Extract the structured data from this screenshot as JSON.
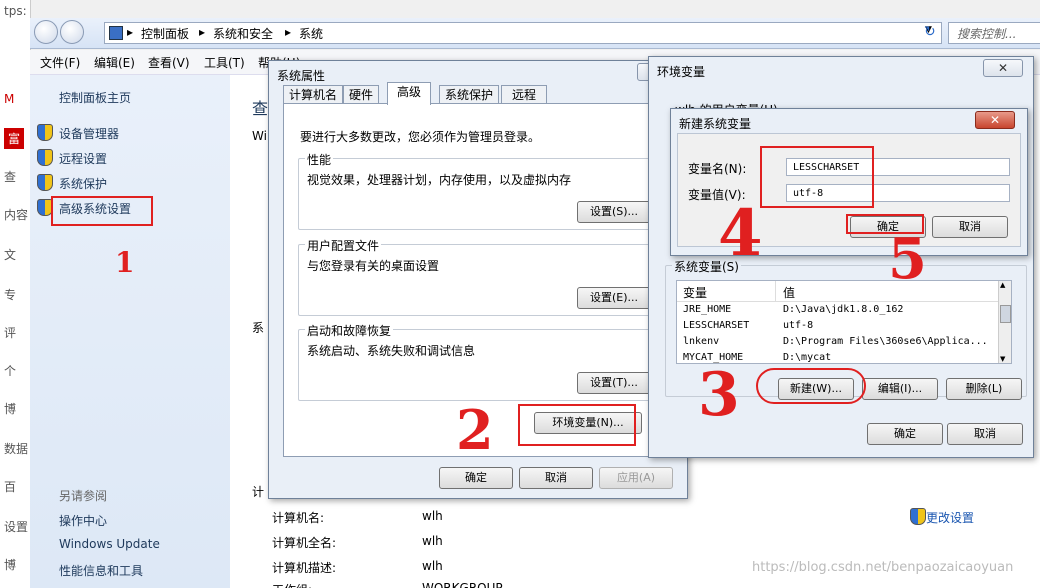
{
  "browser": {
    "url_fragment": "tps:",
    "side_labels": [
      "M",
      "富",
      "查",
      "内容",
      "文",
      "专",
      "评",
      "个",
      "博",
      "数据",
      "百",
      "设置",
      "博"
    ]
  },
  "explorer": {
    "breadcrumb": [
      "控制面板",
      "系统和安全",
      "系统"
    ],
    "search_placeholder": "搜索控制...",
    "menu": [
      "文件(F)",
      "编辑(E)",
      "查看(V)",
      "工具(T)",
      "帮助(H)"
    ],
    "sidebar": {
      "home": "控制面板主页",
      "items": [
        "设备管理器",
        "远程设置",
        "系统保护",
        "高级系统设置"
      ],
      "see_also_title": "另请参阅",
      "see_also": [
        "操作中心",
        "Windows Update",
        "性能信息和工具"
      ]
    },
    "main": {
      "heading_partial": "查",
      "wi_partial": "Wi",
      "sys_partial": "系",
      "comp_partial": "计",
      "rows": [
        {
          "label": "计算机名:",
          "value": "wlh"
        },
        {
          "label": "计算机全名:",
          "value": "wlh"
        },
        {
          "label": "计算机描述:",
          "value": "wlh"
        },
        {
          "label": "工作组:",
          "value": "WORKGROUP"
        }
      ],
      "change_settings": "更改设置"
    }
  },
  "sysprops": {
    "title": "系统属性",
    "tabs": [
      "计算机名",
      "硬件",
      "高级",
      "系统保护",
      "远程"
    ],
    "admin_note": "要进行大多数更改，您必须作为管理员登录。",
    "groups": [
      {
        "title": "性能",
        "desc": "视觉效果，处理器计划，内存使用，以及虚拟内存",
        "button": "设置(S)..."
      },
      {
        "title": "用户配置文件",
        "desc": "与您登录有关的桌面设置",
        "button": "设置(E)..."
      },
      {
        "title": "启动和故障恢复",
        "desc": "系统启动、系统失败和调试信息",
        "button": "设置(T)..."
      }
    ],
    "env_button": "环境变量(N)...",
    "ok": "确定",
    "cancel": "取消",
    "apply": "应用(A)"
  },
  "envvars": {
    "title": "环境变量",
    "user_section_partial": "wlh 的用户变量(U)",
    "system_section": "系统变量(S)",
    "columns": [
      "变量",
      "值"
    ],
    "rows": [
      {
        "name": "JRE_HOME",
        "value": "D:\\Java\\jdk1.8.0_162"
      },
      {
        "name": "LESSCHARSET",
        "value": "utf-8"
      },
      {
        "name": "lnkenv",
        "value": "D:\\Program Files\\360se6\\Applica..."
      },
      {
        "name": "MYCAT_HOME",
        "value": "D:\\mycat"
      }
    ],
    "new": "新建(W)...",
    "edit": "编辑(I)...",
    "delete": "删除(L)",
    "ok": "确定",
    "cancel": "取消"
  },
  "newvar": {
    "title": "新建系统变量",
    "name_label": "变量名(N):",
    "name_value": "LESSCHARSET",
    "value_label": "变量值(V):",
    "value_value": "utf-8",
    "ok": "确定",
    "cancel": "取消"
  },
  "annotations": [
    "1",
    "2",
    "3",
    "4",
    "5"
  ],
  "watermark": "https://blog.csdn.net/benpaozaicaoyuan",
  "colors": {
    "annotation": "#e02020",
    "link": "#1e395b",
    "dialog_bg": "#e9eff7"
  }
}
